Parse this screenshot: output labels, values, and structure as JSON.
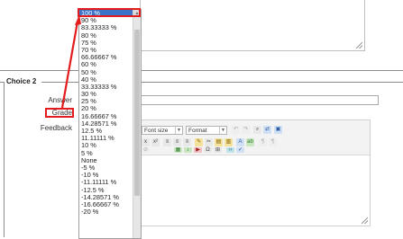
{
  "choice": {
    "legend": "Choice 2"
  },
  "labels": {
    "answer": "Answer",
    "grade": "Grade",
    "feedback": "Feedback"
  },
  "toolbar": {
    "font_size": "Font size",
    "format": "Format"
  },
  "grade_options": [
    "100 %",
    "90 %",
    "83.33333 %",
    "80 %",
    "75 %",
    "70 %",
    "66.66667 %",
    "60 %",
    "50 %",
    "40 %",
    "33.33333 %",
    "30 %",
    "25 %",
    "20 %",
    "16.66667 %",
    "14.28571 %",
    "12.5 %",
    "11.11111 %",
    "10 %",
    "5 %",
    "None",
    "-5 %",
    "-10 %",
    "-11.11111 %",
    "-12.5 %",
    "-14.28571 %",
    "-16.66667 %",
    "-20 %"
  ],
  "selected_index": 0,
  "colors": {
    "selected": "#3a73c7",
    "annotation": "#e31d1d"
  }
}
